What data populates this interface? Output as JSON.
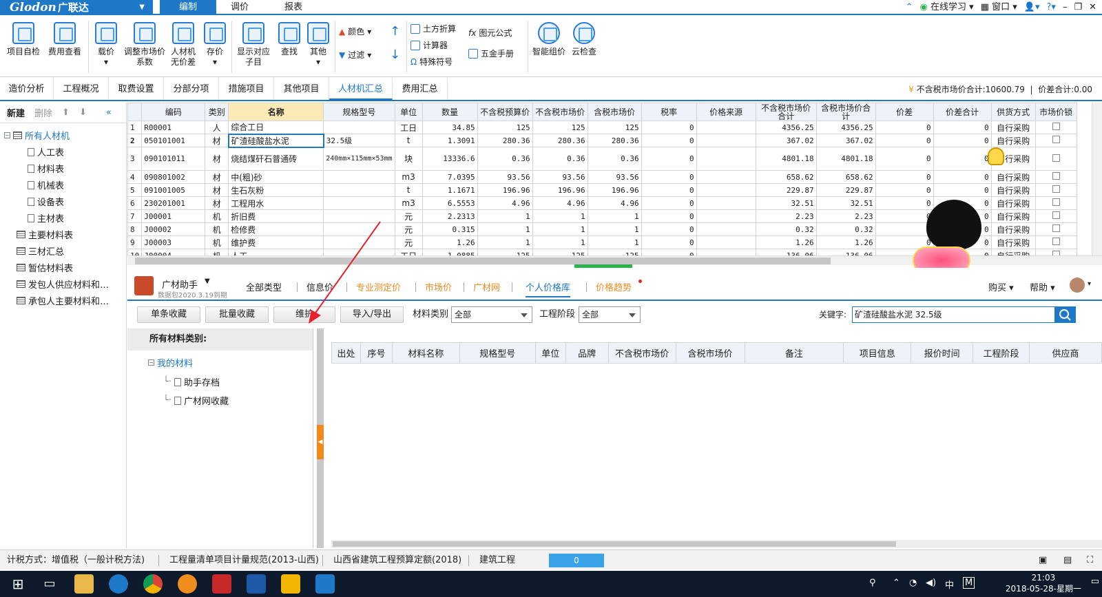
{
  "app": {
    "logo": "Glodon",
    "logo_cn": "广联达",
    "menu_tabs": [
      "编制",
      "调价",
      "报表"
    ],
    "right": {
      "online": "在线学习",
      "window": "窗口"
    }
  },
  "ribbon": {
    "big": [
      "项目自检",
      "费用查看",
      "载价",
      "调整市场价系数",
      "人材机无价差",
      "存价",
      "显示对应子目",
      "查找",
      "其他",
      "智能组价",
      "云检查"
    ],
    "small": {
      "color": "颜色",
      "filter": "过滤",
      "earthwork": "土方折算",
      "calculator": "计算器",
      "special": "特殊符号",
      "formula": "图元公式",
      "hardware": "五金手册"
    }
  },
  "navtabs": [
    "造价分析",
    "工程概况",
    "取费设置",
    "分部分项",
    "措施项目",
    "其他项目",
    "人材机汇总",
    "费用汇总"
  ],
  "navright": {
    "total": "不含税市场价合计:10600.79",
    "diff": "价差合计:0.00"
  },
  "sidebar": {
    "new": "新建",
    "delete": "删除",
    "items": [
      "所有人材机",
      "人工表",
      "材料表",
      "机械表",
      "设备表",
      "主材表",
      "主要材料表",
      "三材汇总",
      "暂估材料表",
      "发包人供应材料和…",
      "承包人主要材料和…"
    ]
  },
  "grid": {
    "headers": [
      "",
      "编码",
      "类别",
      "名称",
      "规格型号",
      "单位",
      "数量",
      "不含税预算价",
      "不含税市场价",
      "含税市场价",
      "税率",
      "价格来源",
      "不含税市场价合计",
      "含税市场价合计",
      "价差",
      "价差合计",
      "供货方式",
      "市场价锁"
    ],
    "rows": [
      [
        "1",
        "R00001",
        "人",
        "综合工日",
        "",
        "工日",
        "34.85",
        "125",
        "125",
        "125",
        "0",
        "",
        "4356.25",
        "4356.25",
        "0",
        "0",
        "自行采购"
      ],
      [
        "2",
        "050101001",
        "材",
        "矿渣硅酸盐水泥",
        "32.5级",
        "t",
        "1.3091",
        "280.36",
        "280.36",
        "280.36",
        "0",
        "",
        "367.02",
        "367.02",
        "0",
        "0",
        "自行采购"
      ],
      [
        "3",
        "090101011",
        "材",
        "烧结煤矸石普通砖",
        "240mm×115mm×53mm",
        "块",
        "13336.6",
        "0.36",
        "0.36",
        "0.36",
        "0",
        "",
        "4801.18",
        "4801.18",
        "0",
        "0",
        "自行采购"
      ],
      [
        "4",
        "090801002",
        "材",
        "中(粗)砂",
        "",
        "m3",
        "7.0395",
        "93.56",
        "93.56",
        "93.56",
        "0",
        "",
        "658.62",
        "658.62",
        "0",
        "0",
        "自行采购"
      ],
      [
        "5",
        "091001005",
        "材",
        "生石灰粉",
        "",
        "t",
        "1.1671",
        "196.96",
        "196.96",
        "196.96",
        "0",
        "",
        "229.87",
        "229.87",
        "0",
        "0",
        "自行采购"
      ],
      [
        "6",
        "230201001",
        "材",
        "工程用水",
        "",
        "m3",
        "6.5553",
        "4.96",
        "4.96",
        "4.96",
        "0",
        "",
        "32.51",
        "32.51",
        "0",
        "0",
        "自行采购"
      ],
      [
        "7",
        "J00001",
        "机",
        "折旧费",
        "",
        "元",
        "2.2313",
        "1",
        "1",
        "1",
        "0",
        "",
        "2.23",
        "2.23",
        "0",
        "0",
        "自行采购"
      ],
      [
        "8",
        "J00002",
        "机",
        "检修费",
        "",
        "元",
        "0.315",
        "1",
        "1",
        "1",
        "0",
        "",
        "0.32",
        "0.32",
        "0",
        "0",
        "自行采购"
      ],
      [
        "9",
        "J00003",
        "机",
        "维护费",
        "",
        "元",
        "1.26",
        "1",
        "1",
        "1",
        "0",
        "",
        "1.26",
        "1.26",
        "0",
        "0",
        "自行采购"
      ],
      [
        "10",
        "J00004",
        "机",
        "人工",
        "",
        "工日",
        "1.0885",
        "125",
        "125",
        "125",
        "0",
        "",
        "136.06",
        "136.06",
        "0",
        "0",
        "自行采购"
      ]
    ]
  },
  "assistant": {
    "title": "广材助手",
    "date": "数据包2020.3.19到期",
    "tabs": [
      "全部类型",
      "信息价",
      "专业测定价",
      "市场价",
      "广材网",
      "个人价格库",
      "价格趋势"
    ],
    "buy": "购买",
    "help": "帮助"
  },
  "tools": {
    "single": "单条收藏",
    "batch": "批量收藏",
    "maintain": "维护",
    "io": "导入/导出",
    "cat_label": "材料类别",
    "cat_value": "全部",
    "stage_label": "工程阶段",
    "stage_value": "全部",
    "kw_label": "关键字:",
    "kw_value": "矿渣硅酸盐水泥 32.5级"
  },
  "category": {
    "head": "所有材料类别:",
    "items": [
      "我的材料",
      "助手存档",
      "广材网收藏"
    ]
  },
  "lower_headers": [
    "出处",
    "序号",
    "材料名称",
    "规格型号",
    "单位",
    "品牌",
    "不含税市场价",
    "含税市场价",
    "备注",
    "项目信息",
    "报价时间",
    "工程阶段",
    "供应商"
  ],
  "status": {
    "tax": "计税方式：增值税（一般计税方法)",
    "spec": "工程量清单项目计量规范(2013-山西)",
    "quota": "山西省建筑工程预算定额(2018)",
    "type": "建筑工程",
    "progress": "0"
  },
  "taskbar": {
    "time": "21:03",
    "date": "2018-05-28-星期一",
    "ime": "中"
  }
}
